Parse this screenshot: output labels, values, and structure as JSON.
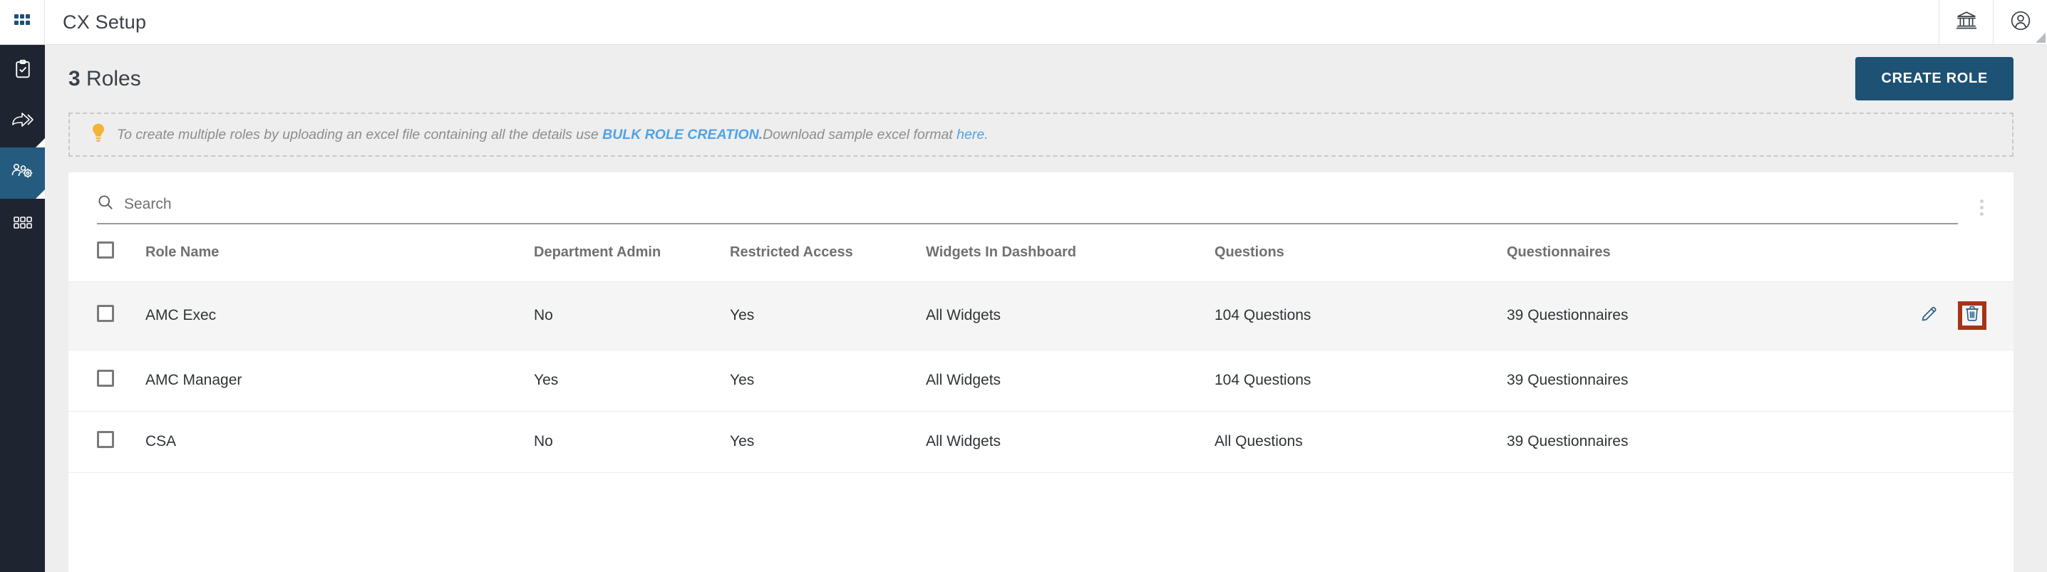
{
  "app": {
    "title": "CX Setup",
    "accent_blue": "#1d5274",
    "rail_bg": "#1e2530",
    "rail_active_bg": "#255b7e",
    "link_blue": "#4ea3e8",
    "highlight_red": "#a63418"
  },
  "rail": {
    "logo_icon": "apps-grid-icon",
    "items": [
      {
        "icon": "clipboard-check-icon",
        "name": "surveys",
        "active": false,
        "has_corner": false
      },
      {
        "icon": "share-arrow-icon",
        "name": "distribution",
        "active": false,
        "has_corner": true
      },
      {
        "icon": "user-gear-icon",
        "name": "cx-setup",
        "active": true,
        "has_corner": true
      },
      {
        "icon": "grid-dots-icon",
        "name": "modules",
        "active": false,
        "has_corner": false
      }
    ]
  },
  "topbar": {
    "title": "CX Setup",
    "buttons": [
      {
        "icon": "bank-icon",
        "name": "organization-button"
      },
      {
        "icon": "user-circle-icon",
        "name": "account-button"
      }
    ]
  },
  "page": {
    "count": "3",
    "count_label": "Roles",
    "create_button": "CREATE ROLE"
  },
  "notice": {
    "icon": "lightbulb-icon",
    "text_before": "To create multiple roles by uploading an excel file containing all the details use ",
    "link_strong": "BULK ROLE CREATION.",
    "text_middle": "Download sample excel format ",
    "link_here": "here."
  },
  "search": {
    "icon": "search-icon",
    "placeholder": "Search",
    "value": "",
    "menu_icon": "kebab-menu-icon"
  },
  "table": {
    "columns": [
      "Role Name",
      "Department Admin",
      "Restricted Access",
      "Widgets In Dashboard",
      "Questions",
      "Questionnaires"
    ],
    "rows": [
      {
        "role_name": "AMC Exec",
        "department_admin": "No",
        "restricted_access": "Yes",
        "widgets": "All Widgets",
        "questions": "104 Questions",
        "questionnaires": "39 Questionnaires",
        "hovered": true,
        "show_actions": true,
        "delete_highlighted": true
      },
      {
        "role_name": "AMC Manager",
        "department_admin": "Yes",
        "restricted_access": "Yes",
        "widgets": "All Widgets",
        "questions": "104 Questions",
        "questionnaires": "39 Questionnaires",
        "hovered": false,
        "show_actions": false,
        "delete_highlighted": false
      },
      {
        "role_name": "CSA",
        "department_admin": "No",
        "restricted_access": "Yes",
        "widgets": "All Widgets",
        "questions": "All Questions",
        "questionnaires": "39 Questionnaires",
        "hovered": false,
        "show_actions": false,
        "delete_highlighted": false
      }
    ],
    "row_actions": [
      {
        "icon": "edit-pencil-icon",
        "name": "edit-role-button"
      },
      {
        "icon": "trash-delete-icon",
        "name": "delete-role-button"
      }
    ]
  }
}
